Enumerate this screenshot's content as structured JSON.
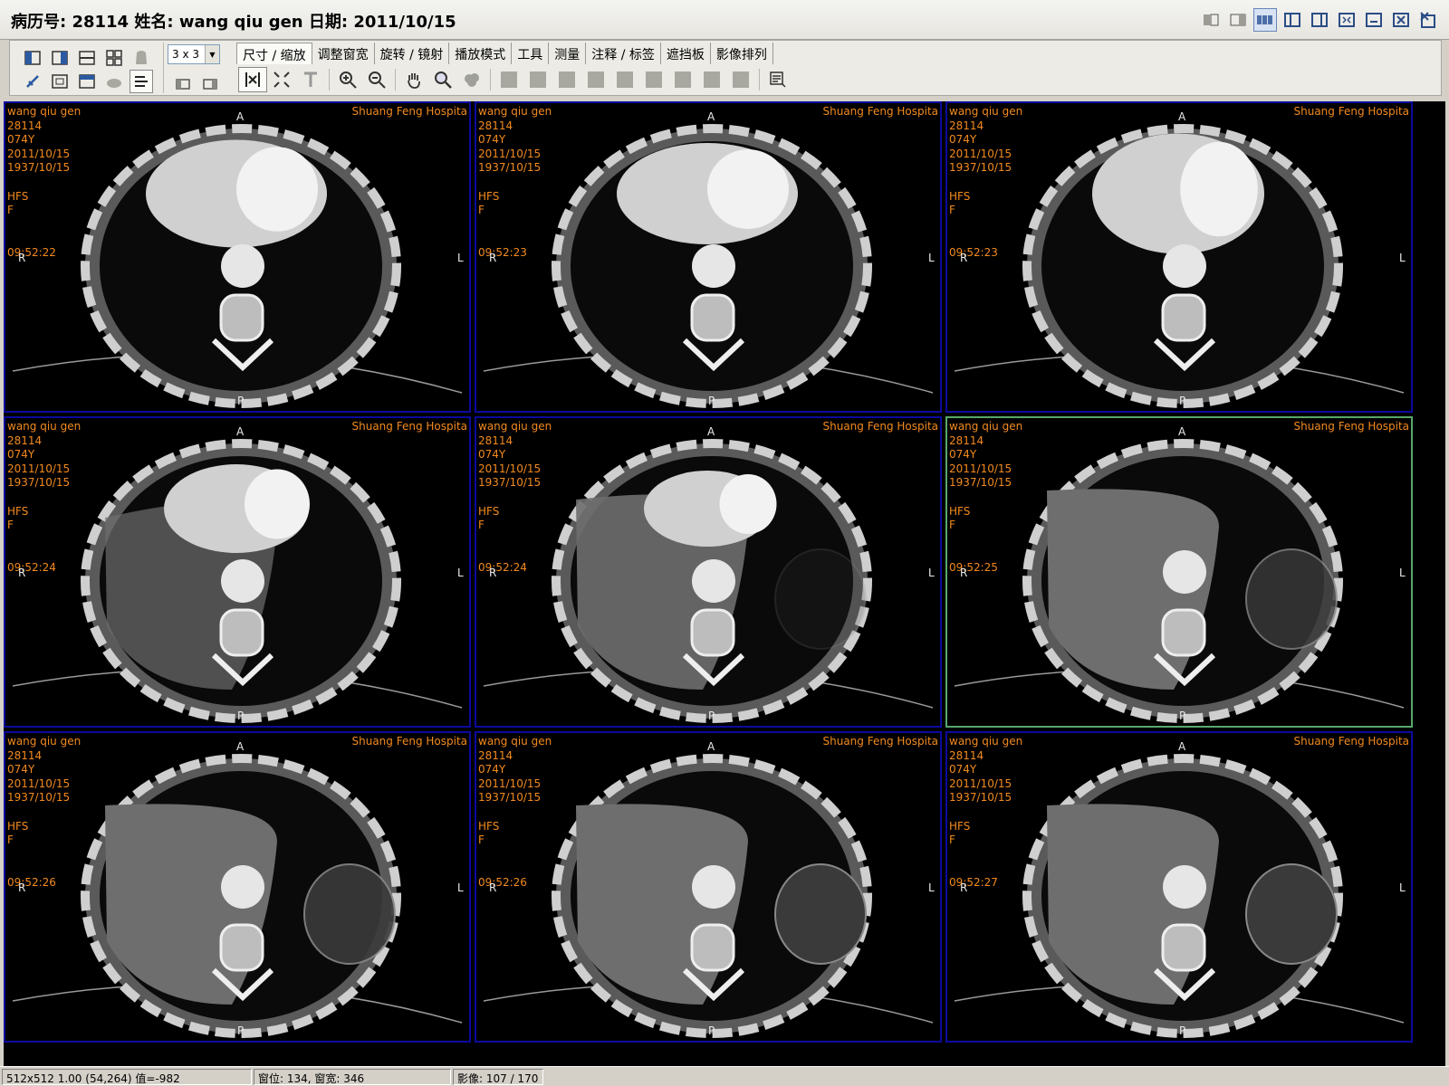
{
  "title": {
    "text": "病历号: 28114 姓名: wang qiu gen 日期: 2011/10/15",
    "buttons": [
      "layout-1-icon",
      "layout-2-icon",
      "layout-3-icon",
      "layout-4-icon",
      "layout-5-icon",
      "fullscreen-icon",
      "minimize-icon",
      "close-icon",
      "exit-icon"
    ]
  },
  "toolbar": {
    "layout_value": "3 x 3",
    "tabs": [
      "尺寸 / 缩放",
      "调整窗宽",
      "旋转 / 镜射",
      "播放模式",
      "工具",
      "测量",
      "注释 / 标签",
      "遮挡板",
      "影像排列"
    ],
    "active_tab": 0,
    "tab_tools": [
      "fit-image-icon",
      "expand-icon",
      "text-icon",
      "zoom-in-icon",
      "zoom-out-icon",
      "pan-hand-icon",
      "magnifier-icon",
      "cloud-icon"
    ]
  },
  "viewer": {
    "rows": 3,
    "cols": 3,
    "selected_cell": 5,
    "cells": [
      {
        "name": "wang qiu gen",
        "id": "28114",
        "age": "074Y",
        "study_date": "2011/10/15",
        "birth_date": "1937/10/15",
        "position": "HFS",
        "sex": "F",
        "time": "09:52:22",
        "hospital": "Shuang Feng Hospita",
        "orient": {
          "a": "A",
          "p": "P",
          "r": "R",
          "l": "L"
        }
      },
      {
        "name": "wang qiu gen",
        "id": "28114",
        "age": "074Y",
        "study_date": "2011/10/15",
        "birth_date": "1937/10/15",
        "position": "HFS",
        "sex": "F",
        "time": "09:52:23",
        "hospital": "Shuang Feng Hospita",
        "orient": {
          "a": "A",
          "p": "P",
          "r": "R",
          "l": "L"
        }
      },
      {
        "name": "wang qiu gen",
        "id": "28114",
        "age": "074Y",
        "study_date": "2011/10/15",
        "birth_date": "1937/10/15",
        "position": "HFS",
        "sex": "F",
        "time": "09:52:23",
        "hospital": "Shuang Feng Hospita",
        "orient": {
          "a": "A",
          "p": "P",
          "r": "R",
          "l": "L"
        }
      },
      {
        "name": "wang qiu gen",
        "id": "28114",
        "age": "074Y",
        "study_date": "2011/10/15",
        "birth_date": "1937/10/15",
        "position": "HFS",
        "sex": "F",
        "time": "09:52:24",
        "hospital": "Shuang Feng Hospita",
        "orient": {
          "a": "A",
          "p": "P",
          "r": "R",
          "l": "L"
        }
      },
      {
        "name": "wang qiu gen",
        "id": "28114",
        "age": "074Y",
        "study_date": "2011/10/15",
        "birth_date": "1937/10/15",
        "position": "HFS",
        "sex": "F",
        "time": "09:52:24",
        "hospital": "Shuang Feng Hospita",
        "orient": {
          "a": "A",
          "p": "P",
          "r": "R",
          "l": "L"
        }
      },
      {
        "name": "wang qiu gen",
        "id": "28114",
        "age": "074Y",
        "study_date": "2011/10/15",
        "birth_date": "1937/10/15",
        "position": "HFS",
        "sex": "F",
        "time": "09:52:25",
        "hospital": "Shuang Feng Hospita",
        "orient": {
          "a": "A",
          "p": "P",
          "r": "R",
          "l": "L"
        }
      },
      {
        "name": "wang qiu gen",
        "id": "28114",
        "age": "074Y",
        "study_date": "2011/10/15",
        "birth_date": "1937/10/15",
        "position": "HFS",
        "sex": "F",
        "time": "09:52:26",
        "hospital": "Shuang Feng Hospita",
        "orient": {
          "a": "A",
          "p": "P",
          "r": "R",
          "l": "L"
        }
      },
      {
        "name": "wang qiu gen",
        "id": "28114",
        "age": "074Y",
        "study_date": "2011/10/15",
        "birth_date": "1937/10/15",
        "position": "HFS",
        "sex": "F",
        "time": "09:52:26",
        "hospital": "Shuang Feng Hospita",
        "orient": {
          "a": "A",
          "p": "P",
          "r": "R",
          "l": "L"
        }
      },
      {
        "name": "wang qiu gen",
        "id": "28114",
        "age": "074Y",
        "study_date": "2011/10/15",
        "birth_date": "1937/10/15",
        "position": "HFS",
        "sex": "F",
        "time": "09:52:27",
        "hospital": "Shuang Feng Hospita",
        "orient": {
          "a": "A",
          "p": "P",
          "r": "R",
          "l": "L"
        }
      }
    ]
  },
  "status": {
    "pixel_info": "512x512  1.00 (54,264) 值=-982",
    "window": "窗位: 134, 窗宽: 346",
    "image_index": "影像: 107 / 170"
  },
  "colors": {
    "overlay_text": "#f28a1e",
    "cell_border": "#0b0b9e",
    "selected_border": "#58a86a"
  }
}
